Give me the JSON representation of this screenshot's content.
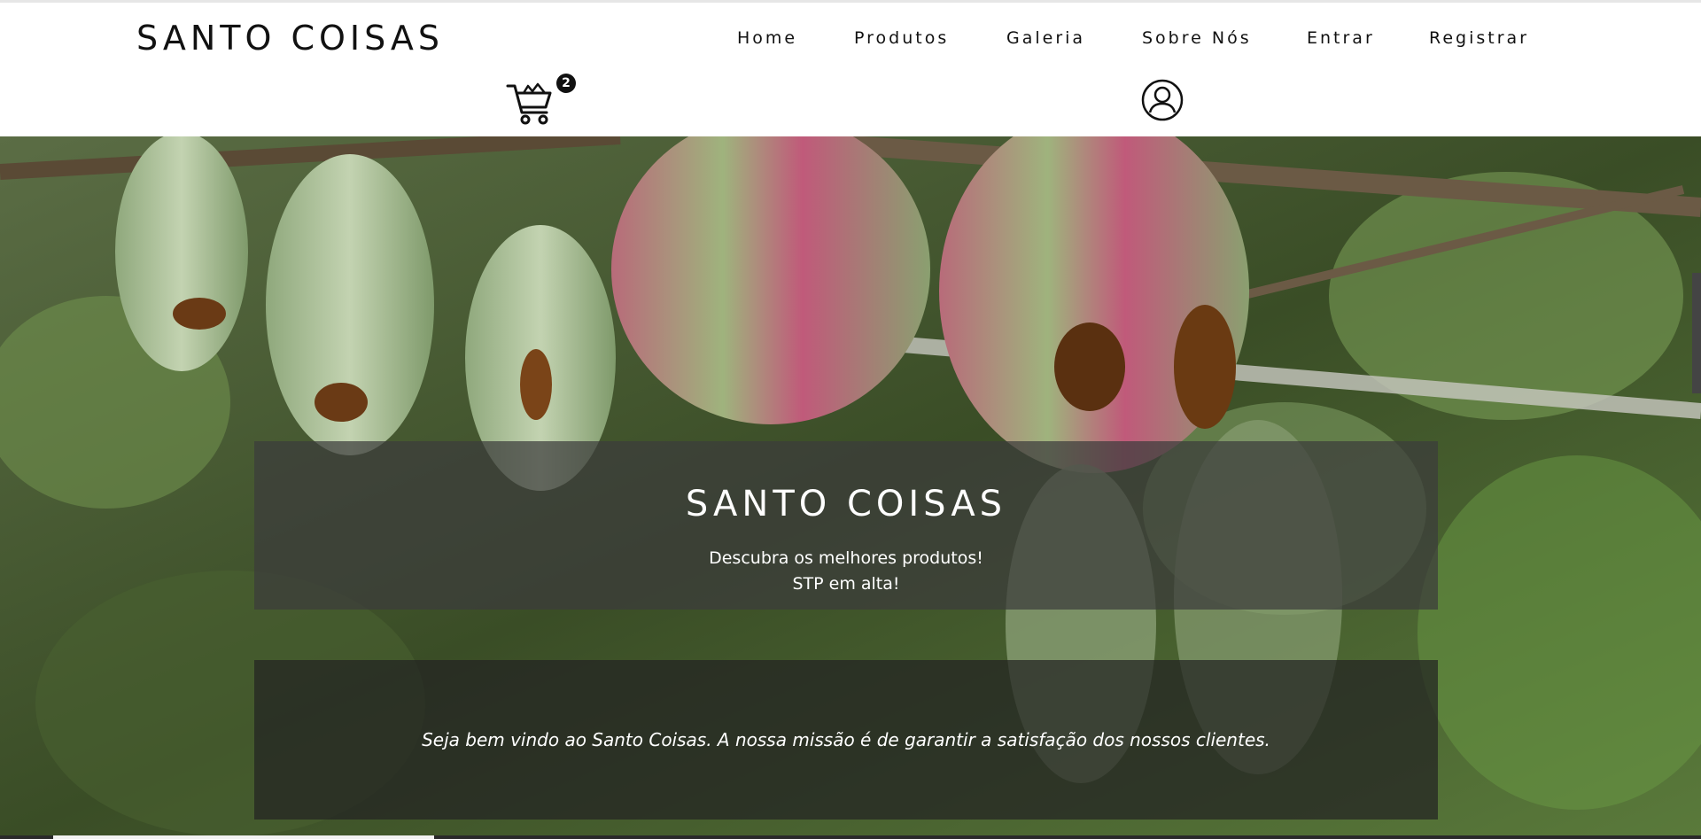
{
  "site": {
    "brand": "SANTO COISAS"
  },
  "nav": {
    "items": [
      {
        "label": "Home"
      },
      {
        "label": "Produtos"
      },
      {
        "label": "Galeria"
      },
      {
        "label": "Sobre Nós"
      },
      {
        "label": "Entrar"
      },
      {
        "label": "Registrar"
      }
    ]
  },
  "cart": {
    "icon": "cart-icon",
    "count": "2"
  },
  "profile": {
    "icon": "user-profile-icon"
  },
  "hero": {
    "image": "cacao-pods-photo",
    "title": "SANTO COISAS",
    "subtitle_line1": "Descubra os melhores produtos!",
    "subtitle_line2": "STP em alta!",
    "welcome": "Seja bem vindo ao Santo Coisas. A nossa missão é de garantir a satisfação dos nossos clientes."
  },
  "colors": {
    "text": "#111111",
    "header_bg": "#ffffff",
    "panel_bg": "#3c3c3c",
    "panel_text": "#ffffff"
  }
}
